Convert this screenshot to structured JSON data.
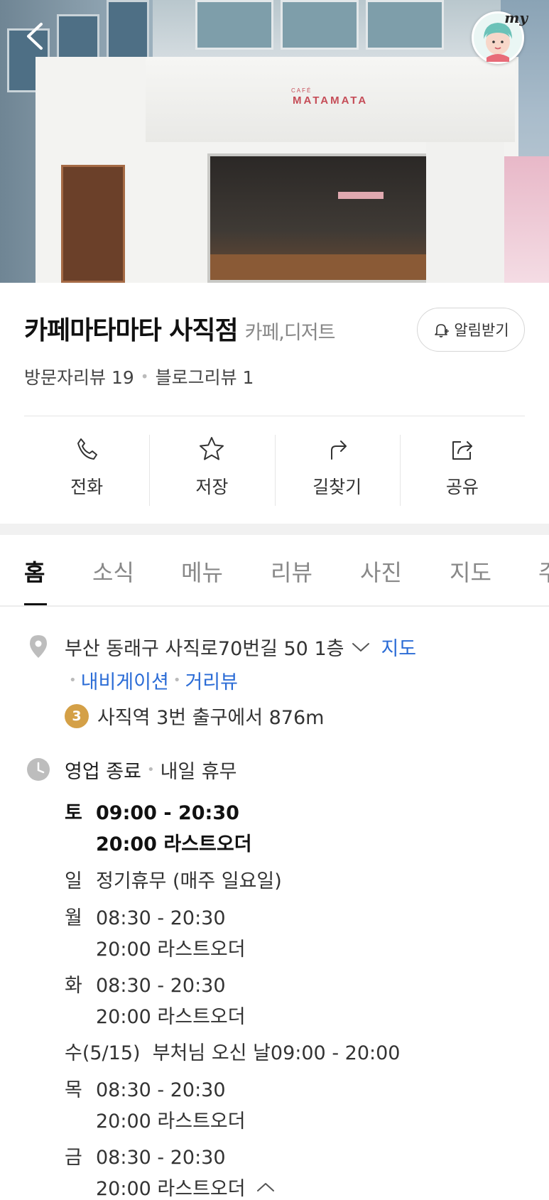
{
  "hero": {
    "sign_small": "CAFÉ",
    "sign_main": "MATAMATA"
  },
  "avatar": {
    "badge": "my"
  },
  "place": {
    "name": "카페마타마타 사직점",
    "category": "카페,디저트",
    "alarm_label": "알림받기",
    "visitor_reviews": "방문자리뷰 19",
    "blog_reviews": "블로그리뷰 1"
  },
  "actions": [
    {
      "label": "전화",
      "icon": "phone-icon"
    },
    {
      "label": "저장",
      "icon": "star-icon"
    },
    {
      "label": "길찾기",
      "icon": "directions-icon"
    },
    {
      "label": "공유",
      "icon": "share-icon"
    }
  ],
  "tabs": [
    "홈",
    "소식",
    "메뉴",
    "리뷰",
    "사진",
    "지도",
    "주"
  ],
  "active_tab": "홈",
  "info": {
    "address": "부산 동래구 사직로70번길 50 1층",
    "map_link": "지도",
    "navigation_link": "내비게이션",
    "streetview_link": "거리뷰",
    "subway_line": "3",
    "subway_text": "사직역 3번 출구에서 876m",
    "status": "영업 종료",
    "next_status": "내일 휴무"
  },
  "hours": [
    {
      "day": "토",
      "time": "09:00 - 20:30",
      "note": "20:00 라스트오더",
      "bold": true
    },
    {
      "day": "일",
      "time": "정기휴무 (매주 일요일)"
    },
    {
      "day": "월",
      "time": "08:30 - 20:30",
      "note": "20:00 라스트오더"
    },
    {
      "day": "화",
      "time": "08:30 - 20:30",
      "note": "20:00 라스트오더"
    },
    {
      "day": "수(5/15)",
      "time": "부처님 오신 날09:00 - 20:00"
    },
    {
      "day": "목",
      "time": "08:30 - 20:30",
      "note": "20:00 라스트오더"
    },
    {
      "day": "금",
      "time": "08:30 - 20:30",
      "note": "20:00 라스트오더"
    }
  ],
  "colors": {
    "link": "#2b6cd6",
    "subway_line3": "#d4a047"
  }
}
